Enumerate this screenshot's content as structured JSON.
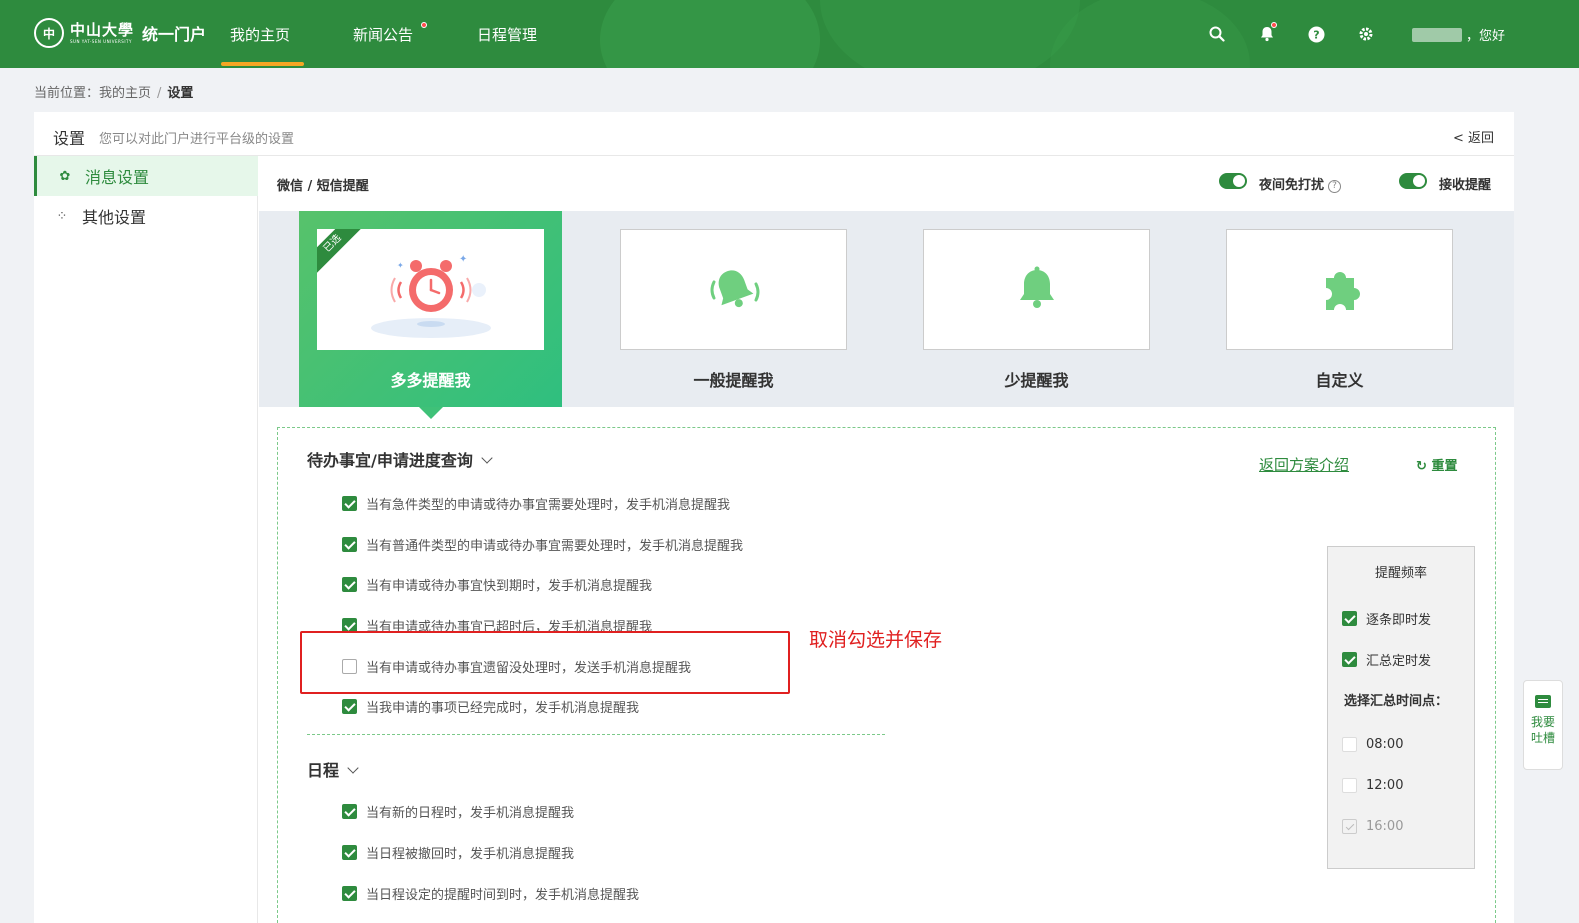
{
  "header": {
    "logo_cn": "中山大學",
    "logo_en": "SUN YAT-SEN UNIVERSITY",
    "portal_name": "统一门户",
    "nav": [
      {
        "label": "我的主页"
      },
      {
        "label": "新闻公告"
      },
      {
        "label": "日程管理"
      }
    ],
    "greeting": "，您好",
    "icons": [
      "search-icon",
      "bell-icon",
      "help-icon",
      "gear-icon"
    ]
  },
  "breadcrumb": {
    "prefix": "当前位置：",
    "home": "我的主页",
    "separator": "/",
    "current": "设置"
  },
  "panel": {
    "title": "设置",
    "subtitle": "您可以对此门户进行平台级的设置",
    "back": "< 返回"
  },
  "sidebar": {
    "items": [
      {
        "label": "消息设置",
        "icon": "gear-icon"
      },
      {
        "label": "其他设置",
        "icon": "apps-icon"
      }
    ]
  },
  "content": {
    "title": "微信 / 短信提醒",
    "toggle_night": "夜间免打扰",
    "toggle_receive": "接收提醒",
    "help_mark": "?"
  },
  "plans": [
    {
      "label": "多多提醒我",
      "badge": "已选"
    },
    {
      "label": "一般提醒我"
    },
    {
      "label": "少提醒我"
    },
    {
      "label": "自定义"
    }
  ],
  "section1": {
    "title": "待办事宜/申请进度查询",
    "back_link": "返回方案介绍",
    "reset": "重置",
    "items": [
      {
        "label": "当有急件类型的申请或待办事宜需要处理时，发手机消息提醒我",
        "checked": true
      },
      {
        "label": "当有普通件类型的申请或待办事宜需要处理时，发手机消息提醒我",
        "checked": true
      },
      {
        "label": "当有申请或待办事宜快到期时，发手机消息提醒我",
        "checked": true
      },
      {
        "label": "当有申请或待办事宜已超时后，发手机消息提醒我",
        "checked": true
      },
      {
        "label": "当有申请或待办事宜遗留没处理时，发送手机消息提醒我",
        "checked": false
      },
      {
        "label": "当我申请的事项已经完成时，发手机消息提醒我",
        "checked": true
      }
    ]
  },
  "annotation": {
    "text": "取消勾选并保存",
    "color": "#e02020"
  },
  "section2": {
    "title": "日程",
    "items": [
      {
        "label": "当有新的日程时，发手机消息提醒我",
        "checked": true
      },
      {
        "label": "当日程被撤回时，发手机消息提醒我",
        "checked": true
      },
      {
        "label": "当日程设定的提醒时间到时，发手机消息提醒我",
        "checked": true
      }
    ]
  },
  "frequency": {
    "title": "提醒频率",
    "options": [
      {
        "label": "逐条即时发",
        "checked": true
      },
      {
        "label": "汇总定时发",
        "checked": true
      }
    ],
    "time_label": "选择汇总时间点：",
    "times": [
      {
        "label": "08:00",
        "state": "unchecked"
      },
      {
        "label": "12:00",
        "state": "unchecked"
      },
      {
        "label": "16:00",
        "state": "disabled-checked"
      }
    ]
  },
  "feedback": {
    "line1": "我要",
    "line2": "吐槽"
  },
  "colors": {
    "brand": "#2e8b3e",
    "accent": "#f5a623",
    "annotation": "#e02020"
  }
}
